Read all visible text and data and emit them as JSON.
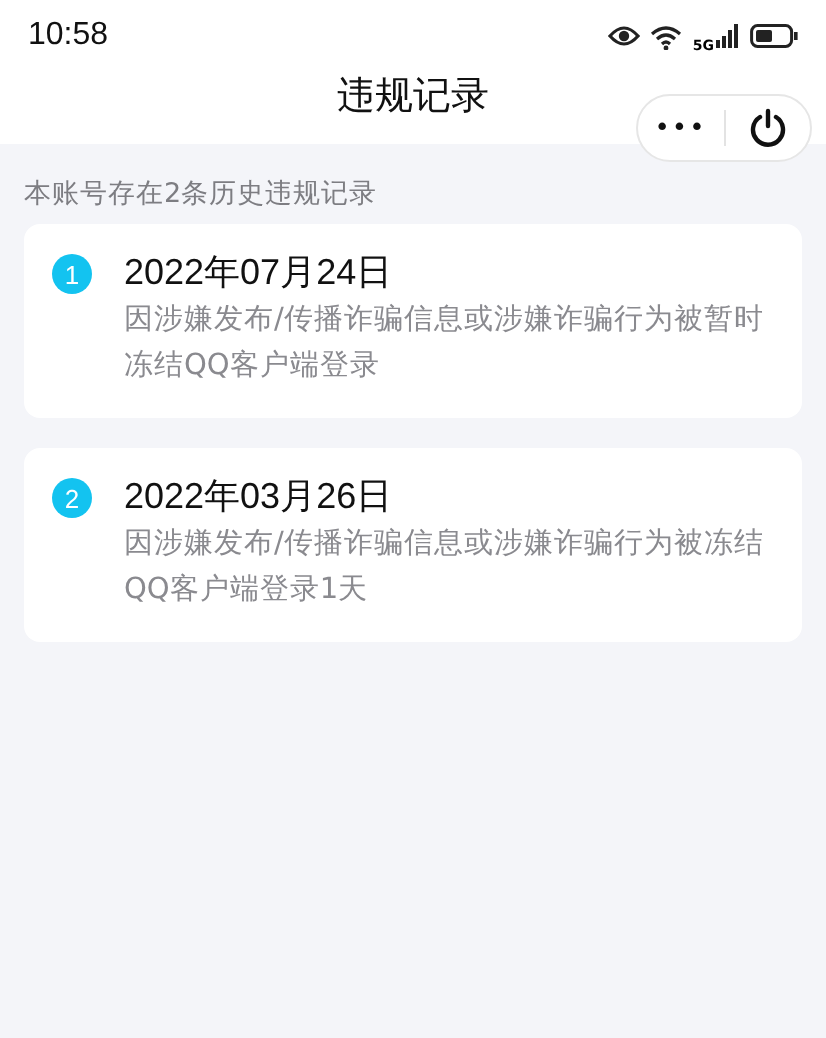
{
  "status_bar": {
    "time": "10:58",
    "network": "5G"
  },
  "header": {
    "title": "违规记录",
    "more_button": "•••"
  },
  "summary": "本账号存在2条历史违规记录",
  "records": [
    {
      "number": "1",
      "date": "2022年07月24日",
      "description_lines": [
        "因涉嫌发布/传播诈骗信息或涉嫌诈骗行为被暂时",
        "冻结QQ客户端登录"
      ]
    },
    {
      "number": "2",
      "date": "2022年03月26日",
      "description_lines": [
        "因涉嫌发布/传播诈骗信息或涉嫌诈骗行为被冻结",
        "QQ客户端登录1天"
      ]
    }
  ]
}
